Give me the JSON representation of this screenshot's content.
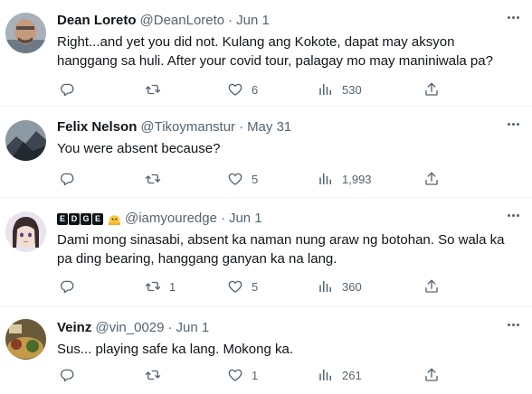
{
  "colors": {
    "text": "#0f1419",
    "secondary": "#536471",
    "divider": "#eff3f4"
  },
  "tweets": [
    {
      "name": "Dean Loreto",
      "handle": "@DeanLoreto",
      "dot": "·",
      "date": "Jun 1",
      "text": "Right...and yet you did not. Kulang ang Kokote, dapat may aksyon\nhanggang sa huli. After your covid tour, palagay mo may maniniwala pa?",
      "replies": "",
      "retweets": "",
      "likes": "6",
      "views": "530"
    },
    {
      "name": "Felix Nelson",
      "handle": "@Tikoymanstur",
      "dot": "·",
      "date": "May 31",
      "text": "You were absent because?",
      "replies": "",
      "retweets": "",
      "likes": "5",
      "views": "1,993"
    },
    {
      "name_letters": [
        "E",
        "D",
        "G",
        "E"
      ],
      "handle": "@iamyouredge",
      "dot": "·",
      "date": "Jun 1",
      "text": "Dami mong sinasabi, absent ka naman nung araw ng botohan. So wala ka\npa ding bearing, hanggang ganyan ka na lang.",
      "replies": "",
      "retweets": "1",
      "likes": "5",
      "views": "360"
    },
    {
      "name": "Veinz",
      "handle": "@vin_0029",
      "dot": "·",
      "date": "Jun 1",
      "text": "Sus... playing safe ka lang. Mokong ka.",
      "replies": "",
      "retweets": "",
      "likes": "1",
      "views": "261"
    }
  ],
  "icons": {
    "reply": "reply-icon",
    "retweet": "retweet-icon",
    "like": "heart-icon",
    "views": "views-chart-icon",
    "share": "share-icon",
    "more": "more-options-icon"
  }
}
